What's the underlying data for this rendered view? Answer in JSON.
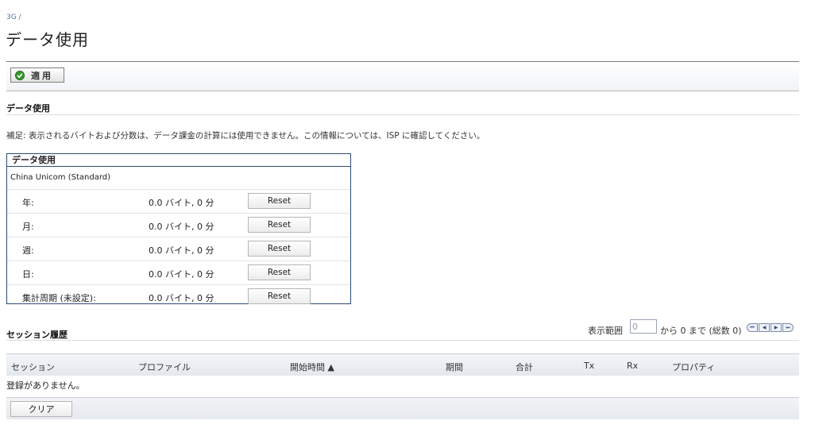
{
  "breadcrumb": "3G /",
  "page_title": "データ使用",
  "toolbar": {
    "apply_label": "適用"
  },
  "section_usage": {
    "title": "データ使用",
    "note": "補足: 表示されるバイトおよび分数は、データ課金の計算には使用できません。この情報については、ISP に確認してください。"
  },
  "usage_box": {
    "header": "データ使用",
    "provider": "China Unicom (Standard)",
    "rows": [
      {
        "label": "年:",
        "value": "0.0 バイト, 0 分",
        "button": "Reset"
      },
      {
        "label": "月:",
        "value": "0.0 バイト, 0 分",
        "button": "Reset"
      },
      {
        "label": "週:",
        "value": "0.0 バイト, 0 分",
        "button": "Reset"
      },
      {
        "label": "日:",
        "value": "0.0 バイト, 0 分",
        "button": "Reset"
      },
      {
        "label": "集計周期 (未設定):",
        "value": "0.0 バイト, 0 分",
        "button": "Reset"
      }
    ]
  },
  "session_history": {
    "title": "セッション履歴",
    "range_prefix": "表示範囲",
    "range_value": "0",
    "range_suffix": "から 0 まで (総数 0)",
    "columns": [
      "セッション",
      "プロファイル",
      "開始時間 ▲",
      "期間",
      "合計",
      "Tx",
      "Rx",
      "プロパティ"
    ],
    "empty_message": "登録がありません。",
    "clear_label": "クリア"
  },
  "pager": {
    "first": "⏮",
    "prev": "◀",
    "next": "▶",
    "last": "⏭"
  }
}
